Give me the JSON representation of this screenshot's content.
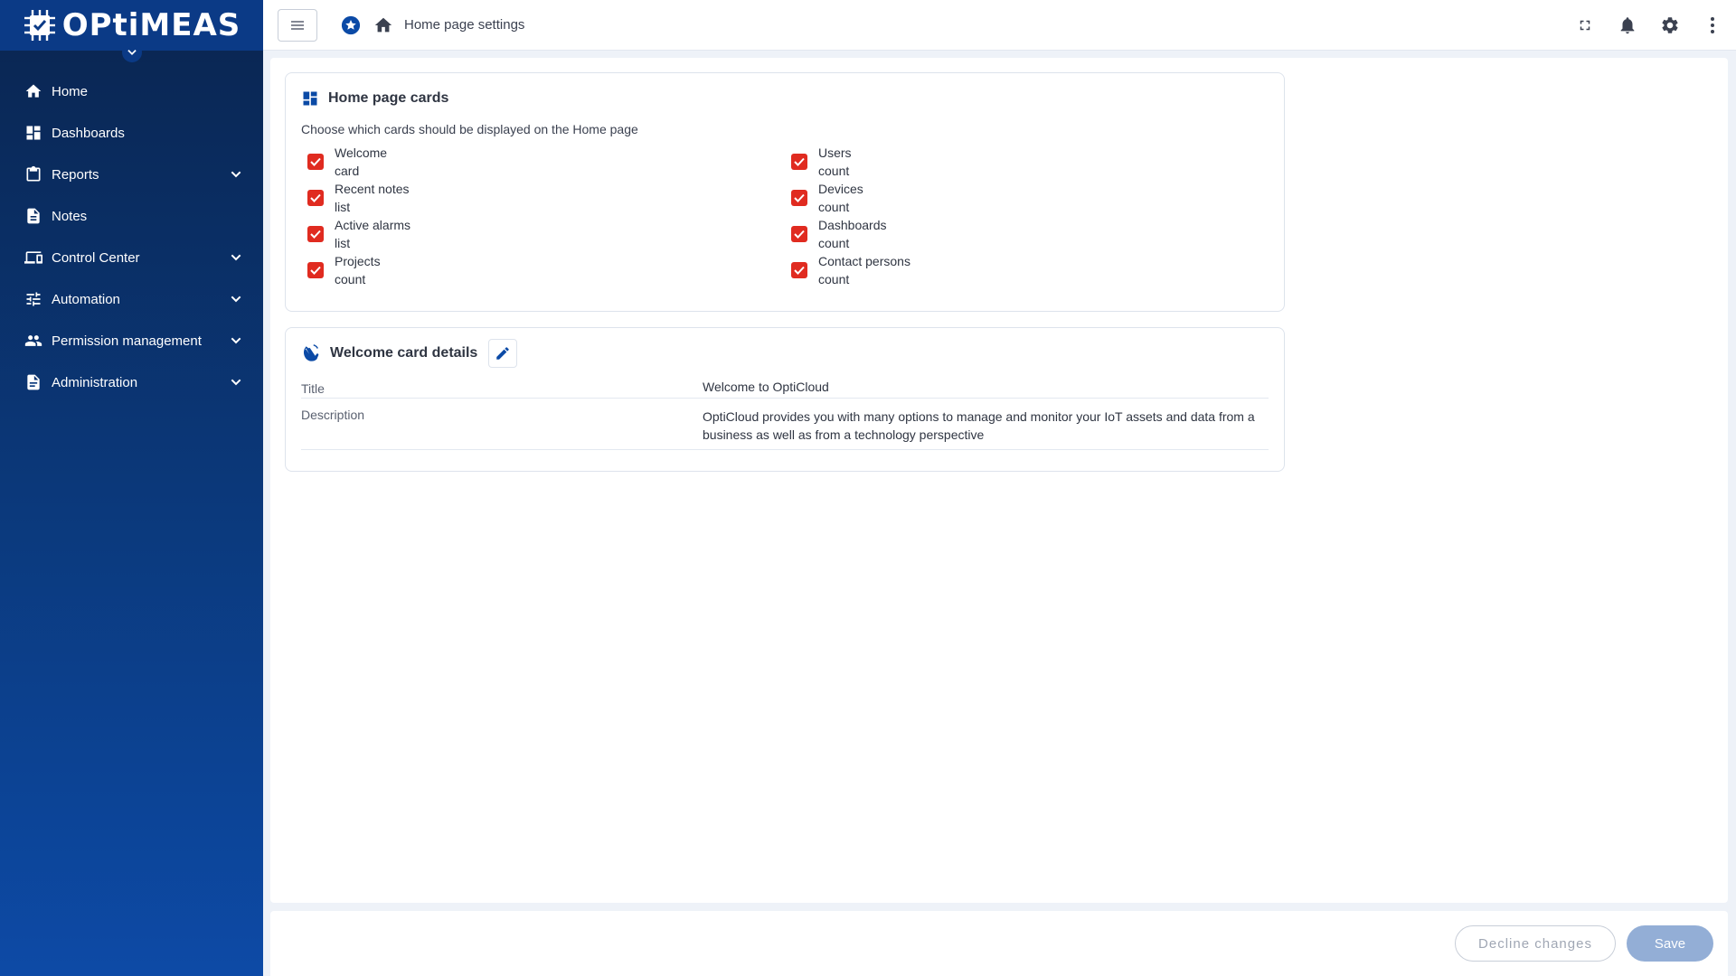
{
  "brand": {
    "logo_text": "OPtiMEAS"
  },
  "sidebar": {
    "items": [
      {
        "label": "Home",
        "icon": "home-icon",
        "expandable": false
      },
      {
        "label": "Dashboards",
        "icon": "dashboard-icon",
        "expandable": false
      },
      {
        "label": "Reports",
        "icon": "clipboard-icon",
        "expandable": true
      },
      {
        "label": "Notes",
        "icon": "document-icon",
        "expandable": false
      },
      {
        "label": "Control Center",
        "icon": "devices-icon",
        "expandable": true
      },
      {
        "label": "Automation",
        "icon": "tune-icon",
        "expandable": true
      },
      {
        "label": "Permission management",
        "icon": "people-icon",
        "expandable": true
      },
      {
        "label": "Administration",
        "icon": "admin-document-icon",
        "expandable": true
      }
    ]
  },
  "header": {
    "breadcrumb": "Home page settings",
    "icons": [
      "menu-icon",
      "favorite-star-icon",
      "home-icon",
      "fullscreen-icon",
      "bell-icon",
      "gear-icon",
      "more-vert-icon"
    ]
  },
  "cards_section": {
    "title": "Home page cards",
    "subtitle": "Choose which cards should be displayed on the Home page",
    "left": [
      {
        "line1": "Welcome",
        "line2": "card",
        "checked": true
      },
      {
        "line1": "Recent notes",
        "line2": "list",
        "checked": true
      },
      {
        "line1": "Active alarms",
        "line2": "list",
        "checked": true
      },
      {
        "line1": "Projects",
        "line2": "count",
        "checked": true
      }
    ],
    "right": [
      {
        "line1": "Users",
        "line2": "count",
        "checked": true
      },
      {
        "line1": "Devices",
        "line2": "count",
        "checked": true
      },
      {
        "line1": "Dashboards",
        "line2": "count",
        "checked": true
      },
      {
        "line1": "Contact persons",
        "line2": "count",
        "checked": true
      }
    ]
  },
  "welcome_section": {
    "title": "Welcome card details",
    "rows": [
      {
        "key": "Title",
        "value": "Welcome to OptiCloud"
      },
      {
        "key": "Description",
        "value": "OptiCloud provides you with many options to manage and monitor your IoT assets and data from a business as well as from a technology perspective"
      }
    ]
  },
  "footer": {
    "decline_label": "Decline changes",
    "save_label": "Save"
  },
  "colors": {
    "sidebar": "#0b3a7e",
    "checkbox": "#e02b20",
    "accent": "#0d4aa6",
    "save_disabled": "#93aed6"
  }
}
